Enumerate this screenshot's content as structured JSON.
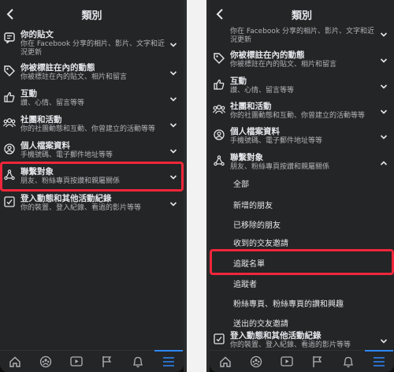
{
  "left": {
    "title": "類別",
    "rows": [
      {
        "icon": "post-icon",
        "title": "你的貼文",
        "sub": "你在 Facebook 分享的相片、影片、文字和近況更新"
      },
      {
        "icon": "tag-icon",
        "title": "你被標註在內的動態",
        "sub": "你被標註在內的貼文、相片和留言"
      },
      {
        "icon": "thumbs-up-icon",
        "title": "互動",
        "sub": "讚、心情、留言等等"
      },
      {
        "icon": "groups-icon",
        "title": "社團和活動",
        "sub": "你的社團動態和互動、你曾建立的活動等等"
      },
      {
        "icon": "profile-icon",
        "title": "個人檔案資料",
        "sub": "手機號碼、電子郵件地址等等"
      },
      {
        "icon": "connections-icon",
        "title": "聯繫對象",
        "sub": "朋友、粉絲專頁按讚和親屬關係"
      },
      {
        "icon": "activity-log-icon",
        "title": "登入動態和其他活動紀錄",
        "sub": "你的裝置、登入紀錄、看過的影片等等"
      }
    ]
  },
  "right": {
    "title": "類別",
    "rows": [
      {
        "icon": "post-icon",
        "title": "",
        "sub": "你在 Facebook 分享的相片、影片、文字和近況更新"
      },
      {
        "icon": "tag-icon",
        "title": "你被標註在內的動態",
        "sub": "你被標註在內的貼文、相片和留言"
      },
      {
        "icon": "thumbs-up-icon",
        "title": "互動",
        "sub": "讚、心情、留言等等"
      },
      {
        "icon": "groups-icon",
        "title": "社團和活動",
        "sub": "你的社團動態和互動、你曾建立的活動等等"
      },
      {
        "icon": "profile-icon",
        "title": "個人檔案資料",
        "sub": "手機號碼、電子郵件地址等等"
      },
      {
        "icon": "connections-icon",
        "title": "聯繫對象",
        "sub": "朋友、粉絲專頁按讚和親屬關係"
      }
    ],
    "subitems": [
      "全部",
      "新增的朋友",
      "已移除的朋友",
      "收到的交友邀請",
      "追蹤名單",
      "追蹤者",
      "粉絲專頁、粉絲專頁的讚和興趣",
      "送出的交友邀請"
    ],
    "last_row": {
      "icon": "activity-log-icon",
      "title": "登入動態和其他活動紀錄",
      "sub": "你的裝置、登入紀錄、看過的影片等等"
    }
  },
  "tabs": [
    "home-icon",
    "groups-tab-icon",
    "watch-icon",
    "flag-icon",
    "bell-icon",
    "menu-icon"
  ],
  "accent": "#2d88ff",
  "highlight_color": "#f0263a"
}
